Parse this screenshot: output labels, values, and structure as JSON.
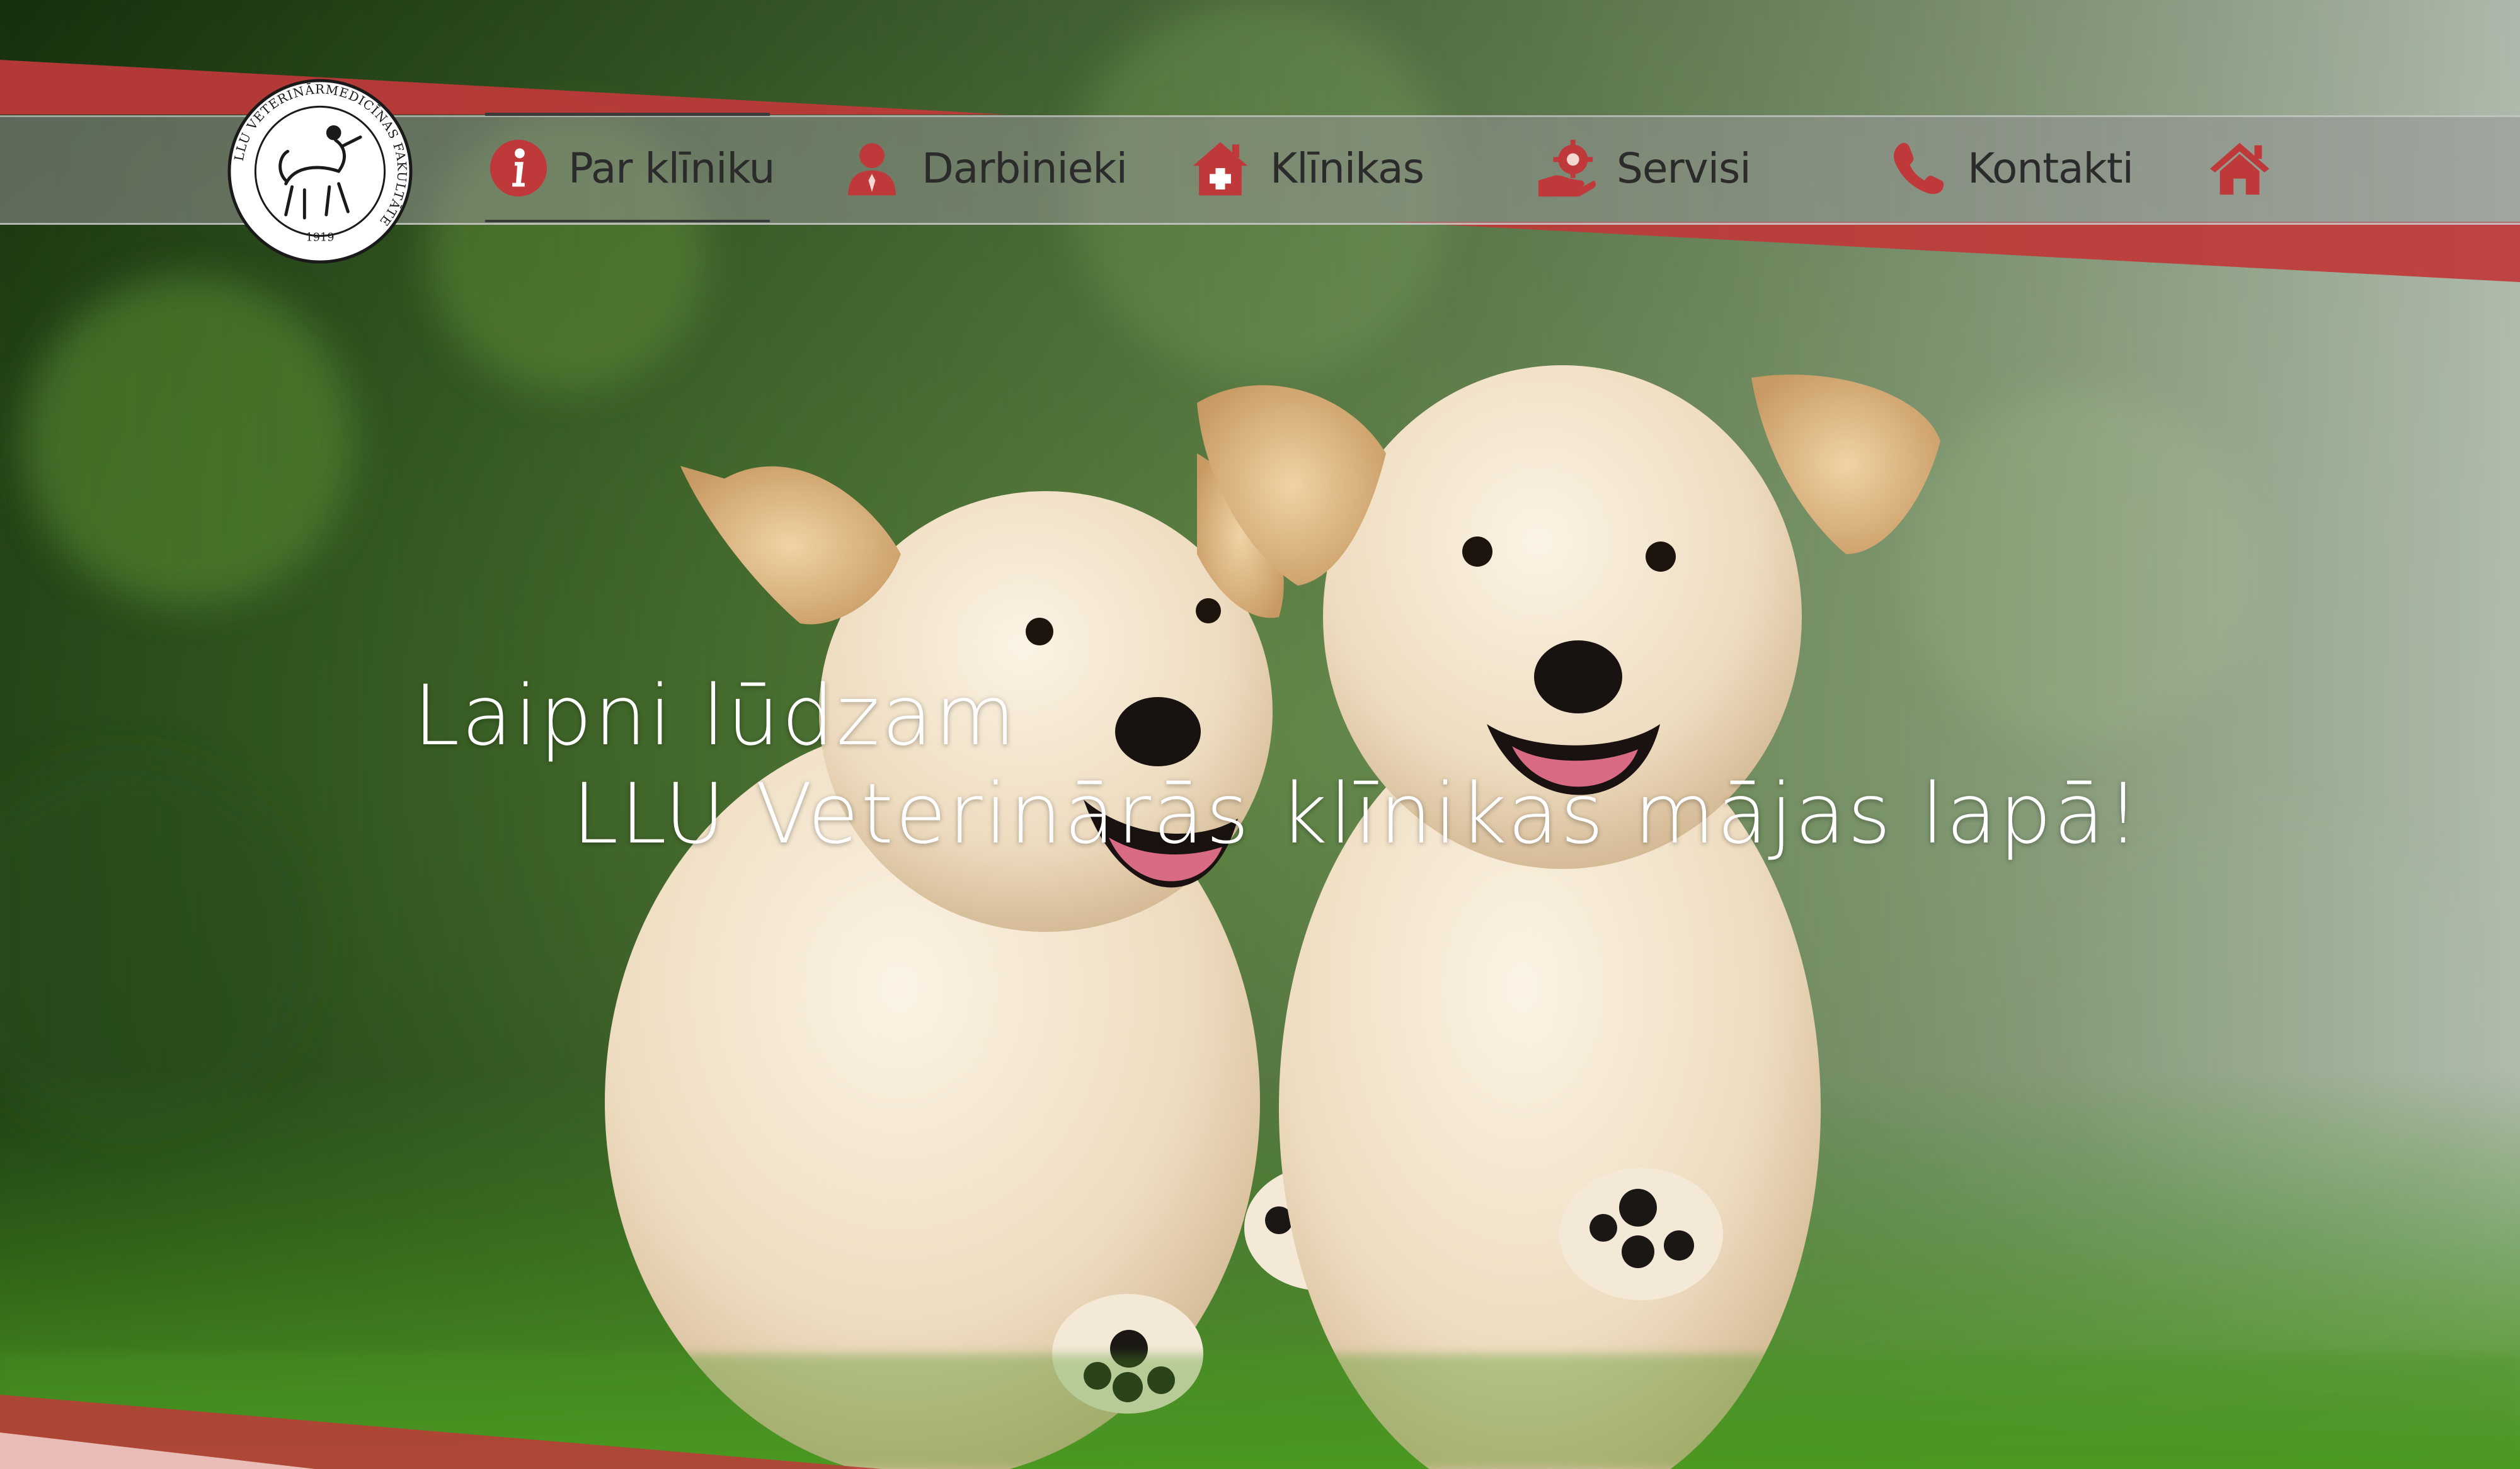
{
  "brand": {
    "logo_text": "LLU VETERINĀRMEDICĪNAS FAKULTĀTE",
    "logo_year": "1919"
  },
  "nav": {
    "items": [
      {
        "label": "Par klīniku",
        "icon": "info-circle-icon",
        "active": true
      },
      {
        "label": "Darbinieki",
        "icon": "person-icon",
        "active": false
      },
      {
        "label": "Klīnikas",
        "icon": "medical-house-icon",
        "active": false
      },
      {
        "label": "Servisi",
        "icon": "hand-gear-icon",
        "active": false
      },
      {
        "label": "Kontakti",
        "icon": "phone-icon",
        "active": false
      }
    ],
    "home_icon": "home-icon"
  },
  "hero": {
    "line1": "Laipni lūdzam",
    "line2": "LLU Veterinārās klīnikas mājas lapā!",
    "image": "two golden retriever puppies running on grass"
  },
  "colors": {
    "accent_red": "#c0393a",
    "nav_text": "#2b2b2b",
    "headline": "#ffffff"
  }
}
